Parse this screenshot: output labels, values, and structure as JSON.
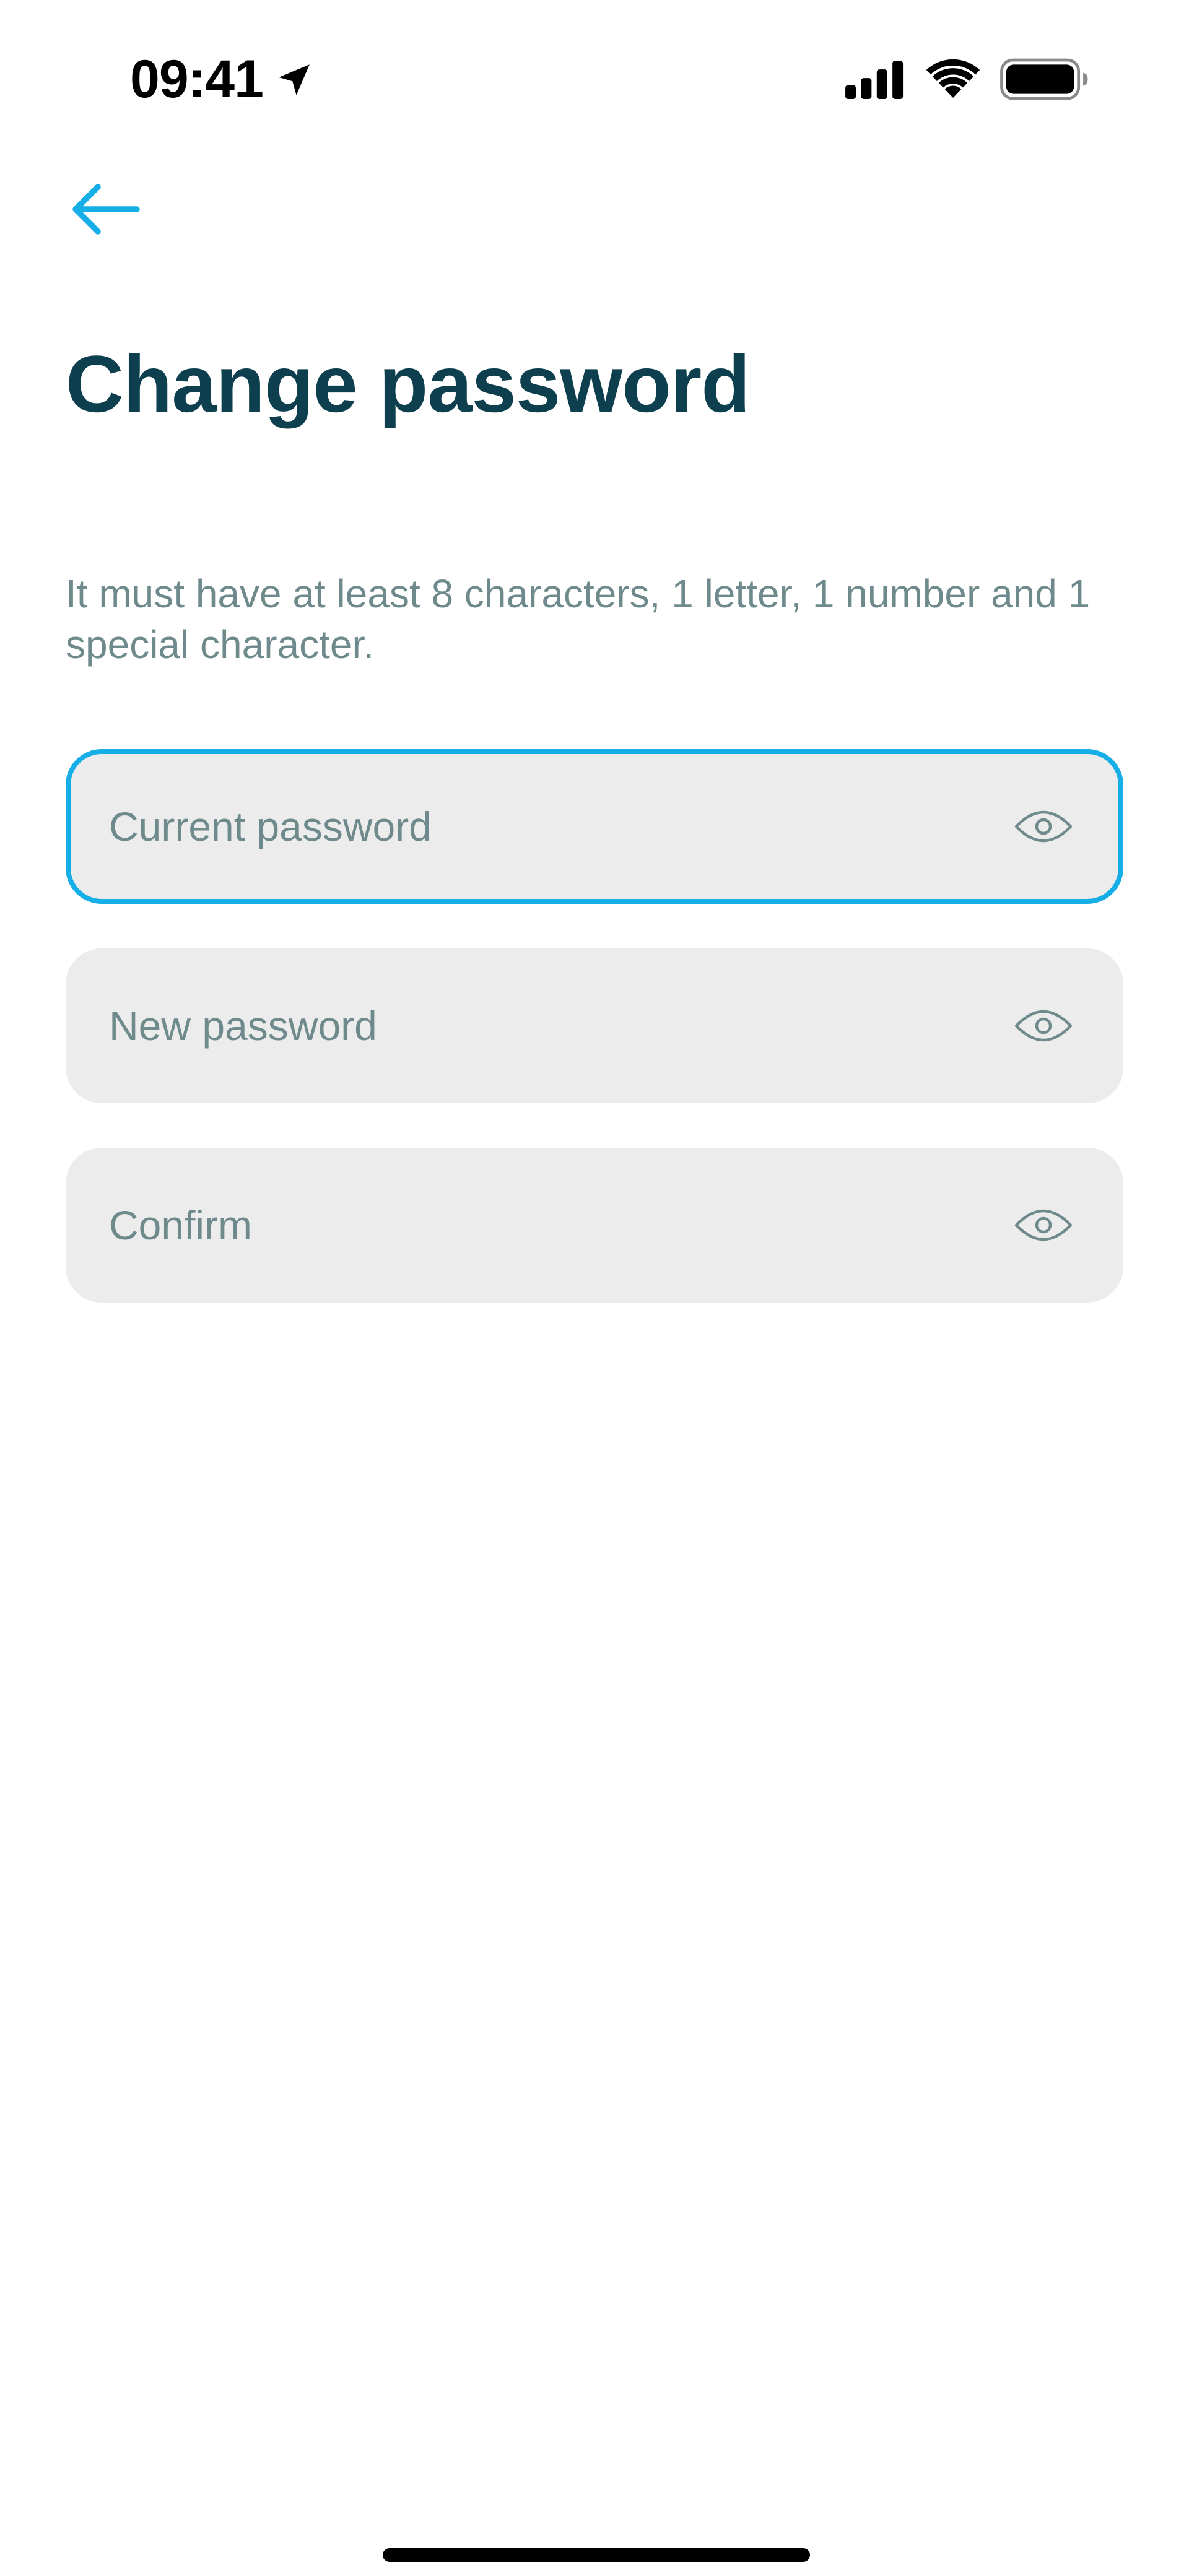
{
  "status_bar": {
    "time": "09:41",
    "icons": [
      "location-arrow-icon",
      "cellular-signal-icon",
      "wifi-icon",
      "battery-icon"
    ]
  },
  "nav": {
    "back_icon": "arrow-left-icon"
  },
  "page": {
    "title": "Change password",
    "hint": "It must have at least 8 characters, 1 letter, 1 number and 1 special character."
  },
  "form": {
    "current_password": {
      "value": "",
      "placeholder": "Current password",
      "focused": true,
      "toggle_icon": "eye-icon"
    },
    "new_password": {
      "value": "",
      "placeholder": "New password",
      "focused": false,
      "toggle_icon": "eye-icon"
    },
    "confirm_password": {
      "value": "",
      "placeholder": "Confirm",
      "focused": false,
      "toggle_icon": "eye-icon"
    }
  },
  "colors": {
    "accent": "#15aee6",
    "title": "#0d3f4e",
    "muted_text": "#6f8a8c",
    "field_background": "#ececec",
    "background": "#ffffff"
  }
}
